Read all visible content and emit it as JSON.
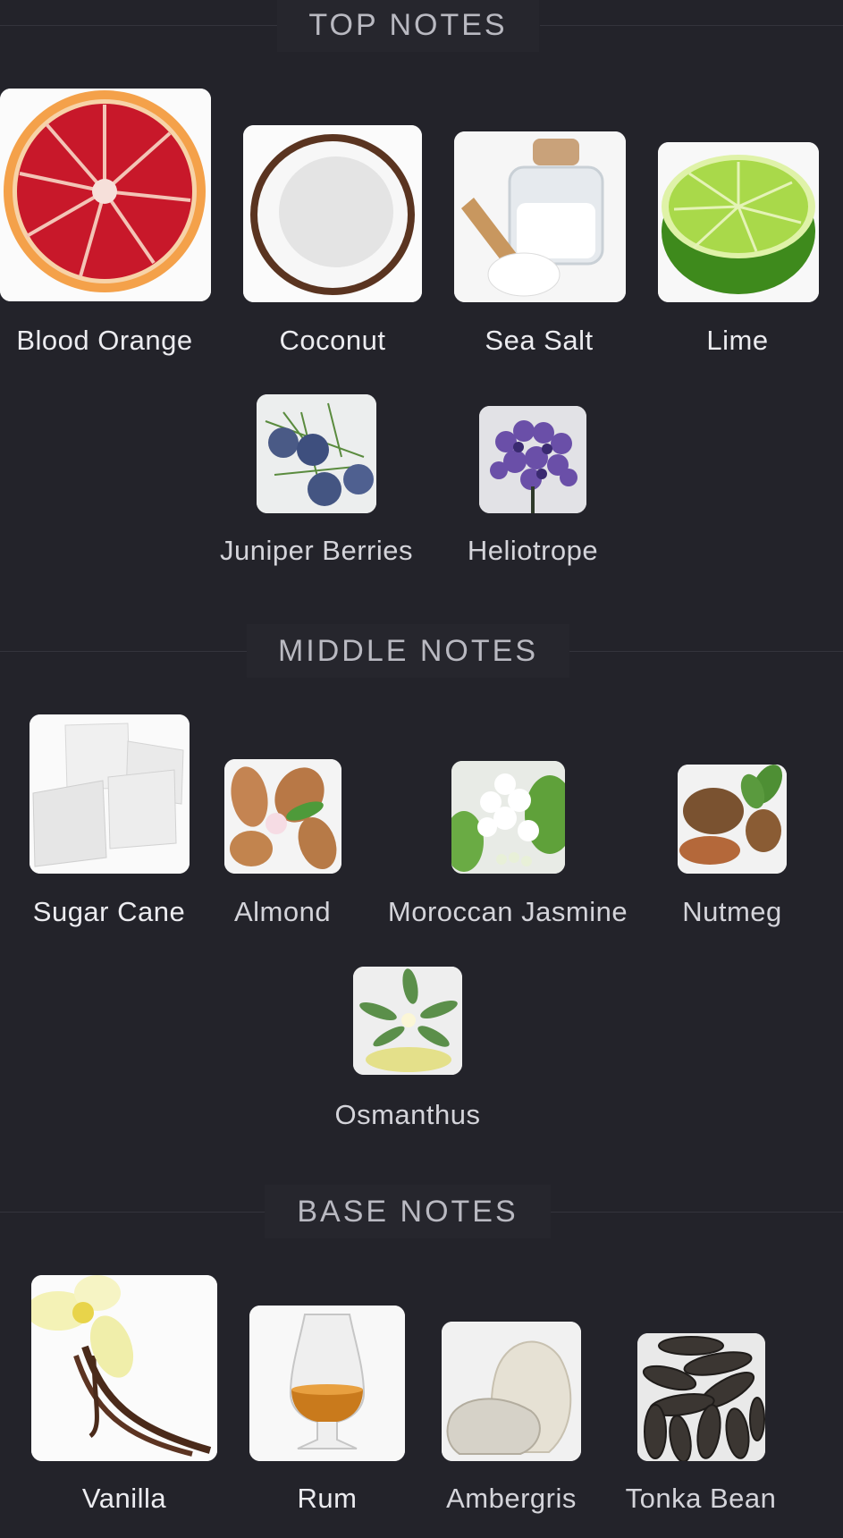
{
  "sections": {
    "top": {
      "title": "TOP NOTES",
      "notes": [
        {
          "name": "Blood Orange",
          "icon": "blood-orange-image"
        },
        {
          "name": "Coconut",
          "icon": "coconut-image"
        },
        {
          "name": "Sea Salt",
          "icon": "sea-salt-image"
        },
        {
          "name": "Lime",
          "icon": "lime-image"
        },
        {
          "name": "Juniper Berries",
          "icon": "juniper-berries-image"
        },
        {
          "name": "Heliotrope",
          "icon": "heliotrope-image"
        }
      ]
    },
    "middle": {
      "title": "MIDDLE NOTES",
      "notes": [
        {
          "name": "Sugar Cane",
          "icon": "sugar-cane-image"
        },
        {
          "name": "Almond",
          "icon": "almond-image"
        },
        {
          "name": "Moroccan Jasmine",
          "icon": "jasmine-image"
        },
        {
          "name": "Nutmeg",
          "icon": "nutmeg-image"
        },
        {
          "name": "Osmanthus",
          "icon": "osmanthus-image"
        }
      ]
    },
    "base": {
      "title": "BASE NOTES",
      "notes": [
        {
          "name": "Vanilla",
          "icon": "vanilla-image"
        },
        {
          "name": "Rum",
          "icon": "rum-image"
        },
        {
          "name": "Ambergris",
          "icon": "ambergris-image"
        },
        {
          "name": "Tonka Bean",
          "icon": "tonka-bean-image"
        }
      ]
    }
  },
  "colors": {
    "background": "#23232a",
    "header_text": "#b9b9c1",
    "caption_text": "#ececf0"
  }
}
